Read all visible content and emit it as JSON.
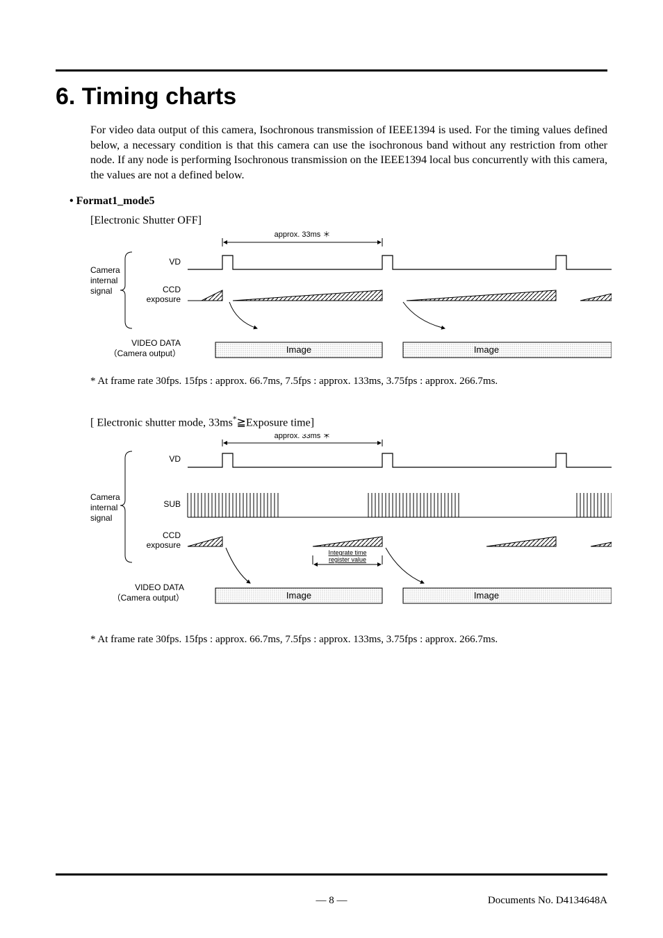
{
  "heading": "6.  Timing charts",
  "intro": "For video data output of this camera, Isochronous transmission of IEEE1394 is used. For the timing values defined below, a necessary condition is that this camera can use the isochronous band without any restriction from other node. If any node is performing Isochronous transmission on the IEEE1394 local bus concurrently with this camera, the values are not a defined below.",
  "section_bullet": "Format1_mode5",
  "diagram1": {
    "caption": "[Electronic Shutter OFF]",
    "period_label": "approx. 33ms ＊",
    "group_label_1": "Camera",
    "group_label_2": "internal",
    "group_label_3": "signal",
    "vd_label": "VD",
    "ccd_label_1": "CCD",
    "ccd_label_2": "exposure",
    "video_label_1": "VIDEO DATA",
    "video_label_2": "（Camera output）",
    "image_label": "Image",
    "footnote": "* At frame rate 30fps. 15fps : approx. 66.7ms, 7.5fps : approx. 133ms, 3.75fps : approx. 266.7ms."
  },
  "diagram2": {
    "caption": "[ Electronic shutter mode, 33ms*≧Exposure time]",
    "period_label": "approx. 33ms ＊",
    "group_label_1": "Camera",
    "group_label_2": "internal",
    "group_label_3": "signal",
    "vd_label": "VD",
    "sub_label": "SUB",
    "ccd_label_1": "CCD",
    "ccd_label_2": "exposure",
    "integrate_label_1": "Integrate time",
    "integrate_label_2": "register value",
    "video_label_1": "VIDEO DATA",
    "video_label_2": "（Camera output）",
    "image_label": "Image",
    "footnote": "* At frame rate 30fps. 15fps : approx. 66.7ms, 7.5fps : approx. 133ms, 3.75fps : approx. 266.7ms."
  },
  "footer": {
    "page": "― 8 ―",
    "docno": "Documents No. D4134648A"
  }
}
